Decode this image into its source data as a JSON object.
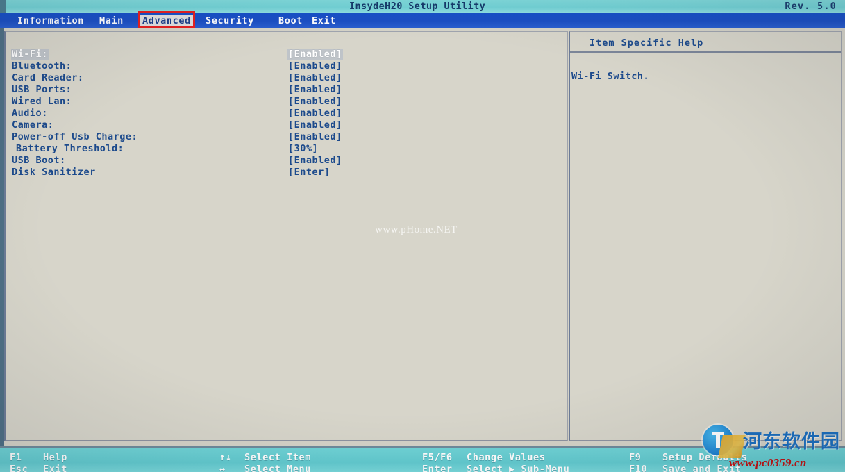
{
  "header": {
    "title": "InsydeH20 Setup Utility",
    "revision": "Rev. 5.0"
  },
  "menu": {
    "items": [
      {
        "label": "Information",
        "active": false
      },
      {
        "label": "Main",
        "active": false
      },
      {
        "label": "Advanced",
        "active": true
      },
      {
        "label": "Security",
        "active": false
      },
      {
        "label": "Boot",
        "active": false
      },
      {
        "label": "Exit",
        "active": false
      }
    ]
  },
  "settings": {
    "rows": [
      {
        "label": "Wi-Fi:",
        "value": "[Enabled]",
        "selected": true,
        "indent": false
      },
      {
        "label": "Bluetooth:",
        "value": "[Enabled]",
        "selected": false,
        "indent": false
      },
      {
        "label": "Card Reader:",
        "value": "[Enabled]",
        "selected": false,
        "indent": false
      },
      {
        "label": "USB Ports:",
        "value": "[Enabled]",
        "selected": false,
        "indent": false
      },
      {
        "label": "Wired Lan:",
        "value": "[Enabled]",
        "selected": false,
        "indent": false
      },
      {
        "label": "Audio:",
        "value": "[Enabled]",
        "selected": false,
        "indent": false
      },
      {
        "label": "Camera:",
        "value": "[Enabled]",
        "selected": false,
        "indent": false
      },
      {
        "label": "Power-off Usb Charge:",
        "value": "[Enabled]",
        "selected": false,
        "indent": false
      },
      {
        "label": "Battery Threshold:",
        "value": "[30%]",
        "selected": false,
        "indent": true
      },
      {
        "label": "USB Boot:",
        "value": "[Enabled]",
        "selected": false,
        "indent": false
      },
      {
        "label": "Disk Sanitizer",
        "value": "[Enter]",
        "selected": false,
        "indent": false
      }
    ]
  },
  "help": {
    "title": "Item Specific Help",
    "body": "Wi-Fi Switch."
  },
  "footer": {
    "columns": [
      {
        "rows": [
          {
            "key": "F1",
            "text": "Help"
          },
          {
            "key": "Esc",
            "text": "Exit"
          }
        ]
      },
      {
        "rows": [
          {
            "key": "↑↓",
            "text": "Select Item"
          },
          {
            "key": "↔",
            "text": "Select Menu"
          }
        ]
      },
      {
        "rows": [
          {
            "key": "F5/F6",
            "text": "Change Values"
          },
          {
            "key": "Enter",
            "text": "Select ▶ Sub-Menu"
          }
        ]
      },
      {
        "rows": [
          {
            "key": "F9",
            "text": "Setup Defaults"
          },
          {
            "key": "F10",
            "text": "Save and Exit"
          }
        ]
      }
    ]
  },
  "watermarks": {
    "center": "www.pHome.NET",
    "logo_text": "河东软件园",
    "url": "www.pc0359.cn"
  },
  "colors": {
    "top_band": "#72d2d6",
    "menu_bar": "#1b4fc4",
    "panel_bg": "#d7d5ca",
    "text_blue": "#1c4a8c",
    "footer": "#62cbd0",
    "annotation_red": "#e62020"
  }
}
